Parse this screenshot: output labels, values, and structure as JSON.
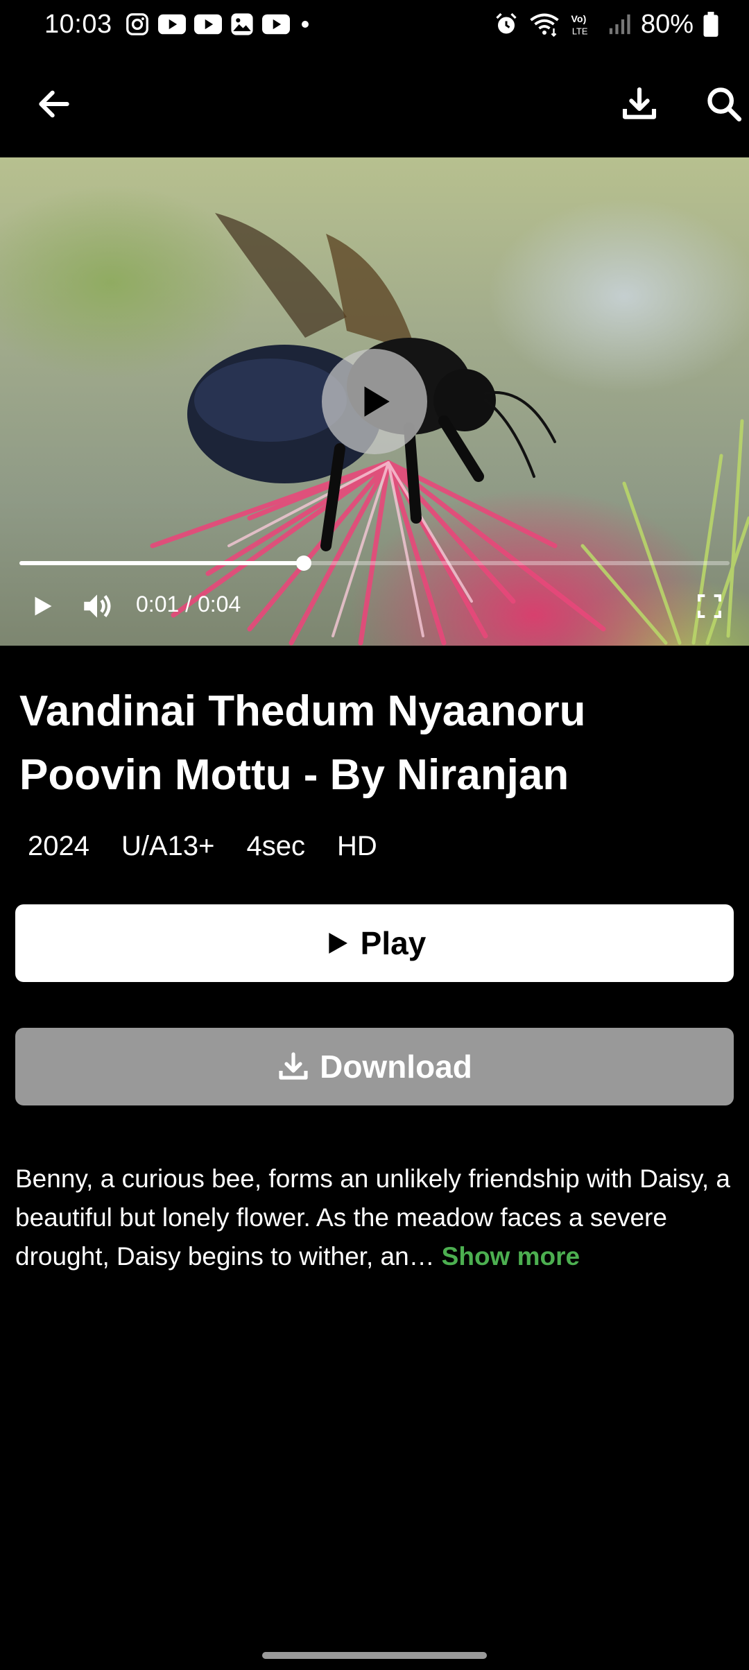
{
  "status_bar": {
    "time": "10:03",
    "battery": "80%",
    "left_icons": [
      "instagram-icon",
      "youtube-icon",
      "youtube-icon",
      "gallery-icon",
      "youtube-icon",
      "dot-icon"
    ],
    "right_icons": [
      "alarm-icon",
      "wifi-icon",
      "volte-icon",
      "signal-icon",
      "battery-icon"
    ],
    "volte_text": "Vo) LTE"
  },
  "app_bar": {
    "icons": [
      "back-arrow-icon",
      "download-icon",
      "search-icon"
    ]
  },
  "player": {
    "elapsed": "0:01",
    "duration": "0:04",
    "time_text": "0:01 / 0:04",
    "progress": 0.4
  },
  "title": "Vandinai Thedum Nyaanoru Poovin Mottu - By Niranjan",
  "meta": {
    "year": "2024",
    "rating": "U/A13+",
    "length": "4sec",
    "quality": "HD"
  },
  "buttons": {
    "play_label": "Play",
    "download_label": "Download"
  },
  "description": {
    "text": "Benny, a curious bee, forms an unlikely friendship with Daisy, a beautiful but lonely flower. As the meadow faces a severe drought, Daisy begins to wither, an…",
    "show_more": "Show more"
  },
  "colors": {
    "background": "#000000",
    "accent_green": "#4caf50",
    "play_button_bg": "#ffffff",
    "download_button_bg": "#999999"
  }
}
